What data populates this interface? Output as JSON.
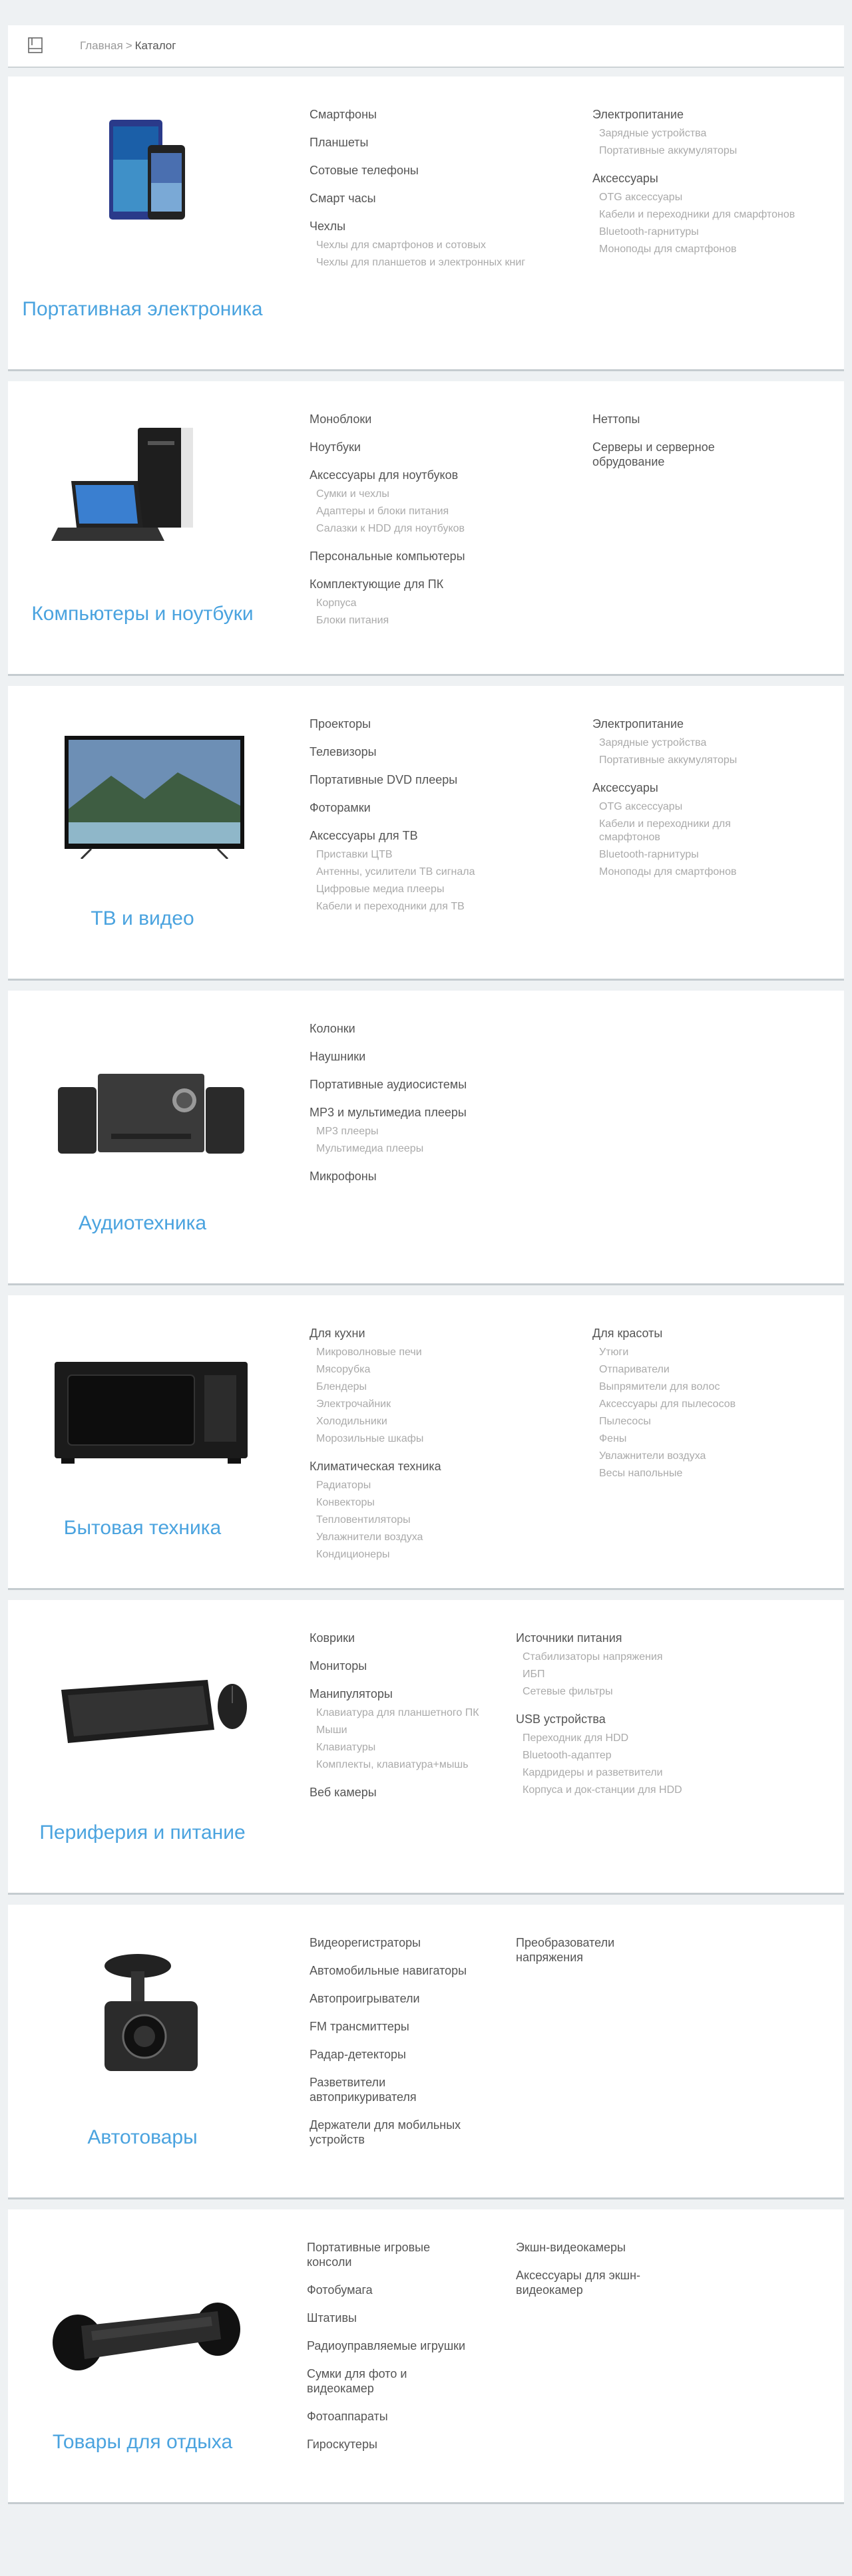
{
  "breadcrumb": {
    "home": "Главная",
    "separator": ">",
    "current": "Каталог"
  },
  "sections": [
    {
      "title": "Портативная электроника",
      "col1": [
        {
          "label": "Смартфоны",
          "subs": []
        },
        {
          "label": "Планшеты",
          "subs": []
        },
        {
          "label": "Сотовые телефоны",
          "subs": []
        },
        {
          "label": "Смарт часы",
          "subs": []
        },
        {
          "label": "Чехлы",
          "subs": [
            "Чехлы для смартфонов и сотовых",
            "Чехлы для планшетов и электронных книг"
          ]
        }
      ],
      "col2": [
        {
          "label": "Электропитание",
          "subs": [
            "Зарядные устройства",
            "Портативные аккумуляторы"
          ]
        },
        {
          "label": "Аксессуары",
          "subs": [
            "OTG аксессуары",
            "Кабели и переходники для смарфтонов",
            "Bluetooth-гарнитуры",
            "Моноподы для смартфонов"
          ]
        }
      ]
    },
    {
      "title": "Компьютеры и ноутбуки",
      "col1": [
        {
          "label": "Моноблоки",
          "subs": []
        },
        {
          "label": "Ноутбуки",
          "subs": []
        },
        {
          "label": "Аксессуары для ноутбуков",
          "subs": [
            "Сумки и чехлы",
            "Адаптеры и блоки питания",
            "Салазки к HDD для ноутбуков"
          ]
        },
        {
          "label": "Персональные компьютеры",
          "subs": []
        },
        {
          "label": "Комплектующие для ПК",
          "subs": [
            "Корпуса",
            "Блоки питания"
          ]
        }
      ],
      "col2": [
        {
          "label": "Неттопы",
          "subs": []
        },
        {
          "label": "Серверы и серверное обрудование",
          "subs": []
        }
      ]
    },
    {
      "title": "ТВ и видео",
      "col1": [
        {
          "label": "Проекторы",
          "subs": []
        },
        {
          "label": "Телевизоры",
          "subs": []
        },
        {
          "label": "Портативные DVD плееры",
          "subs": []
        },
        {
          "label": "Фоторамки",
          "subs": []
        },
        {
          "label": "Аксессуары для ТВ",
          "subs": [
            "Приставки ЦТВ",
            "Антенны, усилители ТВ сигнала",
            "Цифровые медиа плееры",
            "Кабели и переходники для ТВ"
          ]
        }
      ],
      "col2": [
        {
          "label": "Электропитание",
          "subs": [
            "Зарядные устройства",
            "Портативные аккумуляторы"
          ]
        },
        {
          "label": "Аксессуары",
          "subs": [
            "OTG аксессуары",
            "Кабели и переходники для смарфтонов",
            "Bluetooth-гарнитуры",
            "Моноподы для смартфонов"
          ]
        }
      ]
    },
    {
      "title": "Аудиотехника",
      "col1": [
        {
          "label": "Колонки",
          "subs": []
        },
        {
          "label": "Наушники",
          "subs": []
        },
        {
          "label": "Портативные аудиосистемы",
          "subs": []
        },
        {
          "label": "MP3 и мультимедиа плееры",
          "subs": [
            "MP3 плееры",
            "Мультимедиа плееры"
          ]
        },
        {
          "label": "Микрофоны",
          "subs": []
        }
      ],
      "col2": []
    },
    {
      "title": "Бытовая техника",
      "col1": [
        {
          "label": "Для кухни",
          "subs": [
            "Микроволновые печи",
            "Мясорубка",
            "Блендеры",
            "Электрочайник",
            "Холодильники",
            "Морозильные шкафы"
          ]
        },
        {
          "label": "Климатическая техника",
          "subs": [
            "Радиаторы",
            "Конвекторы",
            "Тепловентиляторы",
            "Увлажнители воздуха",
            "Кондиционеры"
          ]
        }
      ],
      "col2": [
        {
          "label": "Для красоты",
          "subs": [
            "Утюги",
            "Отпариватели",
            "Выпрямители для волос",
            "Аксессуары для пылесосов",
            "Пылесосы",
            "Фены",
            "Увлажнители воздуха",
            "Весы напольные"
          ]
        }
      ]
    },
    {
      "title": "Периферия и питание",
      "col1": [
        {
          "label": "Коврики",
          "subs": []
        },
        {
          "label": "Мониторы",
          "subs": []
        },
        {
          "label": "Манипуляторы",
          "subs": [
            "Клавиатура для планшетного ПК",
            "Мыши",
            "Клавиатуры",
            "Комплекты, клавиатура+мышь"
          ]
        },
        {
          "label": "Веб камеры",
          "subs": []
        }
      ],
      "col2": [
        {
          "label": "Источники питания",
          "subs": [
            "Стабилизаторы напряжения",
            "ИБП",
            "Сетевые фильтры"
          ]
        },
        {
          "label": "USB устройства",
          "subs": [
            "Переходник для HDD",
            "Bluetooth-адаптер",
            "Кардридеры и разветвители",
            "Корпуса и док-станции для HDD"
          ]
        }
      ]
    },
    {
      "title": "Автотовары",
      "col1": [
        {
          "label": "Видеорегистраторы",
          "subs": []
        },
        {
          "label": "Автомобильные навигаторы",
          "subs": []
        },
        {
          "label": "Автопроигрыватели",
          "subs": []
        },
        {
          "label": "FM трансмиттеры",
          "subs": []
        },
        {
          "label": "Радар-детекторы",
          "subs": []
        },
        {
          "label": "Разветвители автоприкуривателя",
          "subs": []
        },
        {
          "label": "Держатели для мобильных устройств",
          "subs": []
        }
      ],
      "col2": [
        {
          "label": "Преобразователи напряжения",
          "subs": []
        }
      ]
    },
    {
      "title": "Товары для отдыха",
      "col1": [
        {
          "label": "Портативные игровые консоли",
          "subs": []
        },
        {
          "label": "Фотобумага",
          "subs": []
        },
        {
          "label": "Штативы",
          "subs": []
        },
        {
          "label": "Радиоуправляемые игрушки",
          "subs": []
        },
        {
          "label": "Сумки для фото и видеокамер",
          "subs": []
        },
        {
          "label": "Фотоаппараты",
          "subs": []
        },
        {
          "label": "Гироскутеры",
          "subs": []
        }
      ],
      "col2": [
        {
          "label": "Экшн-видеокамеры",
          "subs": []
        },
        {
          "label": "Аксессуары для экшн-видеокамер",
          "subs": []
        }
      ]
    }
  ]
}
